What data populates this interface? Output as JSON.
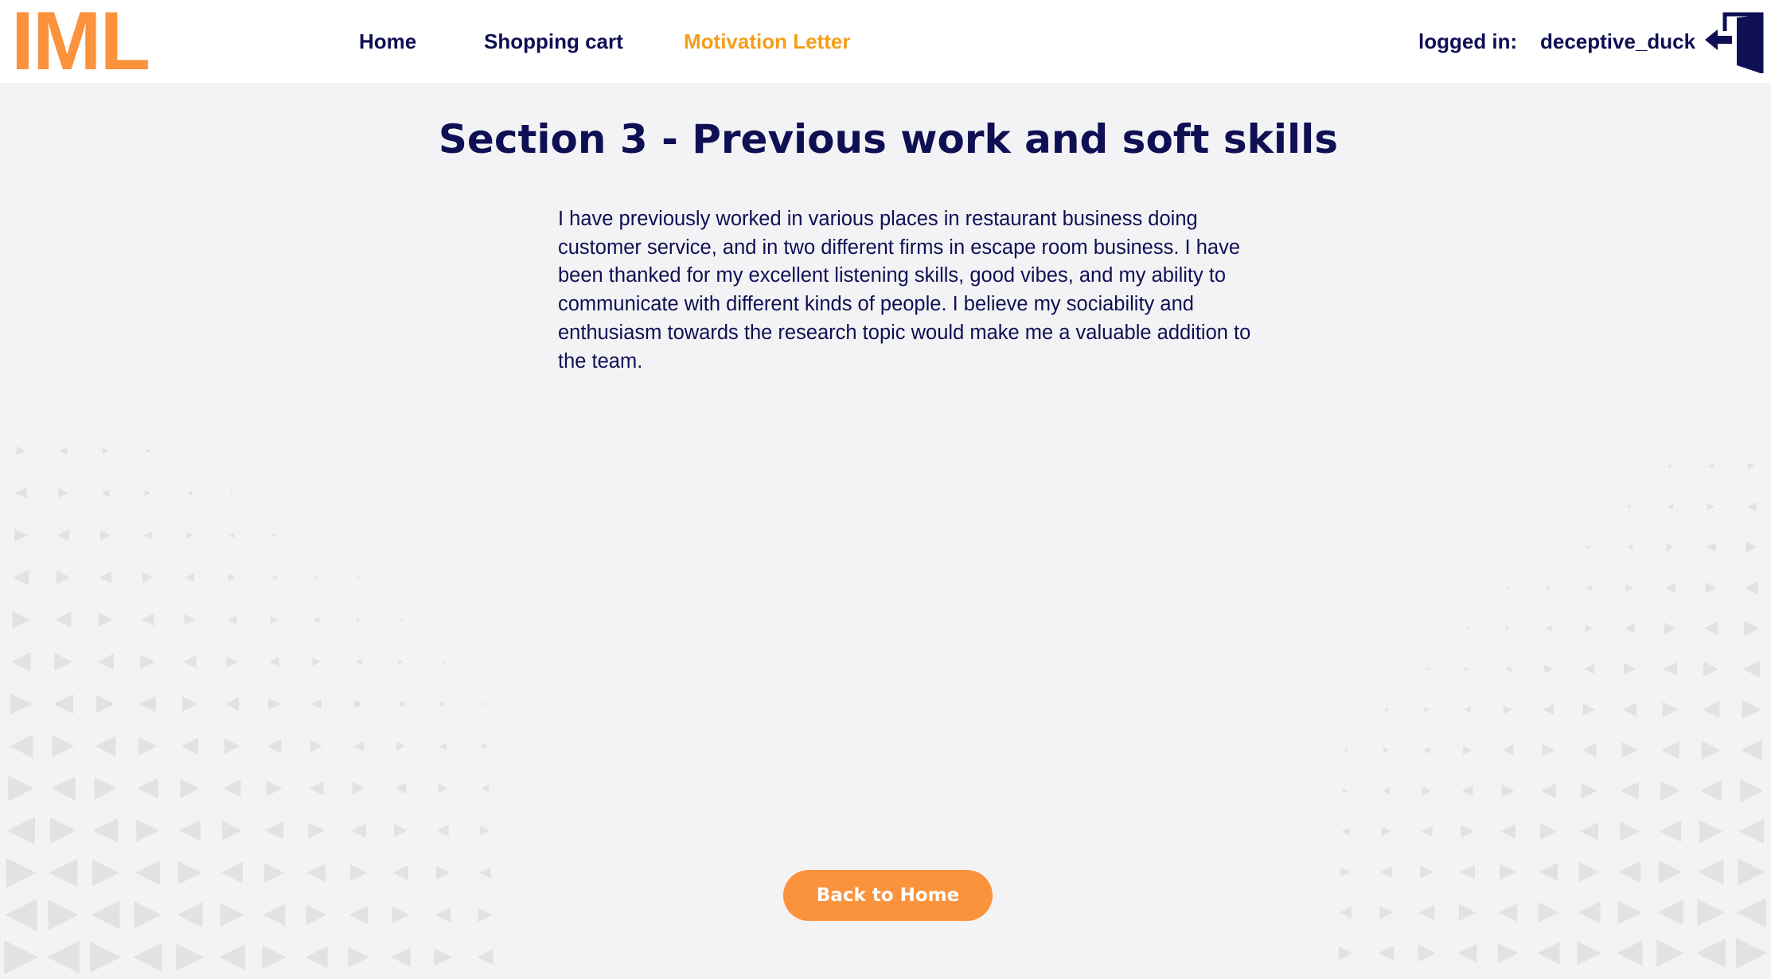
{
  "header": {
    "logo_text": "IML",
    "nav": {
      "home_label": "Home",
      "cart_label": "Shopping cart",
      "letter_label": "Motivation Letter"
    },
    "user": {
      "logged_in_label": "logged in:",
      "username": "deceptive_duck"
    },
    "logout_icon": "logout-door-icon"
  },
  "main": {
    "title": "Section 3 - Previous work and soft skills",
    "body": "I have previously worked in various places in restaurant business doing customer service, and in two different firms in escape room business. I have been thanked for my excellent listening skills, good vibes, and my ability to communicate with different kinds of people. I believe my sociability and enthusiasm towards the research topic would make me a valuable addition to the team.",
    "back_button_label": "Back to Home"
  },
  "colors": {
    "accent": "#fb923c",
    "active_nav": "#f59e1b",
    "text_primary": "#0f0f54",
    "background": "#f3f3f5",
    "pattern": "#e2e2e5"
  }
}
